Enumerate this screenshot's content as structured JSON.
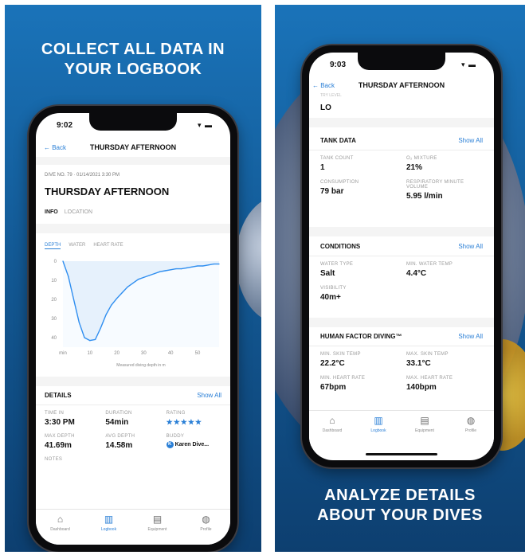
{
  "left_panel": {
    "headline_line1": "COLLECT ALL DATA IN",
    "headline_line2": "YOUR LOGBOOK",
    "phone": {
      "status_time": "9:02",
      "status_icons": "▾ ▬",
      "back_label": "← Back",
      "nav_title": "THURSDAY AFTERNOON",
      "dive_meta": "DIVE NO. 79 · 01/14/2021 3:30 PM",
      "dive_title": "THURSDAY AFTERNOON",
      "tabs": [
        {
          "label": "INFO"
        },
        {
          "label": "LOCATION"
        }
      ],
      "chart_tabs": [
        {
          "label": "DEPTH"
        },
        {
          "label": "WATER"
        },
        {
          "label": "HEART RATE"
        }
      ],
      "details_heading": "DETAILS",
      "details_show_all": "Show All",
      "details": {
        "time_in_label": "TIME IN",
        "time_in": "3:30 PM",
        "duration_label": "DURATION",
        "duration": "54min",
        "rating_label": "RATING",
        "rating": "★★★★★",
        "max_depth_label": "MAX DEPTH",
        "max_depth": "41.69m",
        "avg_depth_label": "AVG DEPTH",
        "avg_depth": "14.58m",
        "buddy_label": "BUDDY",
        "buddy": "Karen Dive...",
        "buddy_initial": "K",
        "notes_label": "NOTES"
      }
    }
  },
  "right_panel": {
    "headline_line1": "ANALYZE DETAILS",
    "headline_line2": "ABOUT YOUR DIVES",
    "phone": {
      "status_time": "9:03",
      "status_icons": "▾ ▬",
      "back_label": "← Back",
      "nav_title": "THURSDAY AFTERNOON",
      "top_label": "TRY LEVEL",
      "top_value": "LO",
      "tank": {
        "heading": "TANK DATA",
        "show_all": "Show All",
        "count_label": "TANK COUNT",
        "count": "1",
        "mixture_label": "O₂ MIXTURE",
        "mixture": "21%",
        "consumption_label": "CONSUMPTION",
        "consumption": "79 bar",
        "rmv_label": "RESPIRATORY MINUTE VOLUME",
        "rmv": "5.95 l/min"
      },
      "conditions": {
        "heading": "CONDITIONS",
        "show_all": "Show All",
        "water_type_label": "WATER TYPE",
        "water_type": "Salt",
        "min_temp_label": "MIN. WATER TEMP",
        "min_temp": "4.4°C",
        "visibility_label": "VISIBILITY",
        "visibility": "40m+"
      },
      "human": {
        "heading": "HUMAN FACTOR DIVING™",
        "show_all": "Show All",
        "min_skin_label": "MIN. SKIN TEMP",
        "min_skin": "22.2°C",
        "max_skin_label": "MAX. SKIN TEMP",
        "max_skin": "33.1°C",
        "min_hr_label": "MIN. HEART RATE",
        "min_hr": "67bpm",
        "max_hr_label": "MAX. HEART RATE",
        "max_hr": "140bpm"
      }
    }
  },
  "tabbar": [
    {
      "label": "Dashboard",
      "icon": "⌂",
      "icon_name": "home-icon"
    },
    {
      "label": "Logbook",
      "icon": "▥",
      "icon_name": "book-icon"
    },
    {
      "label": "Equipment",
      "icon": "▤",
      "icon_name": "equipment-icon"
    },
    {
      "label": "Profile",
      "icon": "◍",
      "icon_name": "profile-icon"
    }
  ],
  "chart_data": {
    "type": "line",
    "title": "",
    "xlabel": "Measured diving depth in m",
    "ylabel": "",
    "x_ticks": [
      "min",
      "10",
      "20",
      "30",
      "40",
      "50"
    ],
    "y_ticks": [
      "0",
      "10",
      "20",
      "30",
      "40"
    ],
    "xlim": [
      0,
      58
    ],
    "ylim": [
      0,
      45
    ],
    "y_inverted": true,
    "grid": false,
    "series": [
      {
        "x": [
          0,
          2,
          4,
          6,
          8,
          10,
          12,
          14,
          16,
          18,
          20,
          22,
          24,
          26,
          28,
          30,
          32,
          34,
          36,
          38,
          40,
          42,
          44,
          46,
          48,
          50,
          52,
          54,
          56,
          58
        ],
        "y": [
          0,
          8,
          20,
          32,
          40,
          41.5,
          41,
          35,
          28,
          23,
          19.5,
          16.5,
          13.5,
          11.5,
          9.5,
          8.5,
          7.5,
          6.5,
          5.5,
          5,
          4.5,
          4,
          4,
          3.5,
          3,
          2.5,
          2.5,
          2,
          1.5,
          1.5
        ]
      }
    ],
    "colors": {
      "line": "#2f8ef0",
      "fill": "#e6f1fc"
    }
  }
}
